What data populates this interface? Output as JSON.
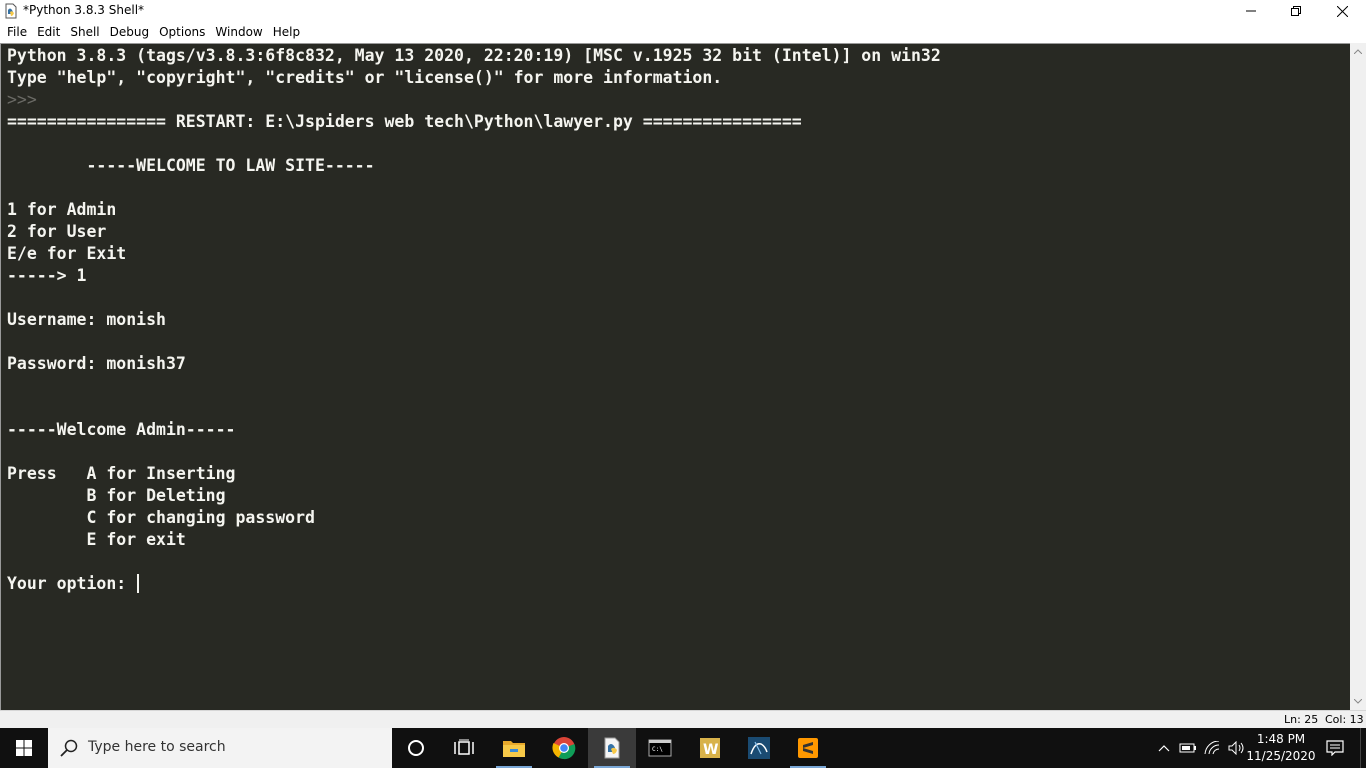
{
  "window": {
    "title": "*Python 3.8.3 Shell*"
  },
  "menu": [
    "File",
    "Edit",
    "Shell",
    "Debug",
    "Options",
    "Window",
    "Help"
  ],
  "shell": {
    "lines": [
      {
        "text": "Python 3.8.3 (tags/v3.8.3:6f8c832, May 13 2020, 22:20:19) [MSC v.1925 32 bit (Intel)] on win32",
        "kind": "output"
      },
      {
        "text": "Type \"help\", \"copyright\", \"credits\" or \"license()\" for more information.",
        "kind": "output"
      },
      {
        "text": ">>> ",
        "kind": "prompt"
      },
      {
        "text": "================ RESTART: E:\\Jspiders web tech\\Python\\lawyer.py ================",
        "kind": "output"
      },
      {
        "text": "",
        "kind": "output"
      },
      {
        "text": "        -----WELCOME TO LAW SITE-----",
        "kind": "output"
      },
      {
        "text": "",
        "kind": "output"
      },
      {
        "text": "1 for Admin",
        "kind": "output"
      },
      {
        "text": "2 for User",
        "kind": "output"
      },
      {
        "text": "E/e for Exit",
        "kind": "output"
      },
      {
        "text": "-----> 1",
        "kind": "output"
      },
      {
        "text": "",
        "kind": "output"
      },
      {
        "text": "Username: monish",
        "kind": "output"
      },
      {
        "text": "",
        "kind": "output"
      },
      {
        "text": "Password: monish37",
        "kind": "output"
      },
      {
        "text": "",
        "kind": "output"
      },
      {
        "text": "",
        "kind": "output"
      },
      {
        "text": "-----Welcome Admin-----",
        "kind": "output"
      },
      {
        "text": "",
        "kind": "output"
      },
      {
        "text": "Press   A for Inserting",
        "kind": "output"
      },
      {
        "text": "        B for Deleting",
        "kind": "output"
      },
      {
        "text": "        C for changing password",
        "kind": "output"
      },
      {
        "text": "        E for exit",
        "kind": "output"
      },
      {
        "text": "",
        "kind": "output"
      },
      {
        "text": "Your option: ",
        "kind": "input"
      }
    ]
  },
  "status": {
    "ln": "Ln: 25",
    "col": "Col: 13"
  },
  "taskbar": {
    "search_placeholder": "Type here to search",
    "apps": [
      "cortana-icon",
      "task-view-icon",
      "file-explorer-icon",
      "chrome-icon",
      "python-idle-icon",
      "command-prompt-icon",
      "word-icon",
      "mysql-workbench-icon",
      "sublime-text-icon"
    ],
    "time": "1:48 PM",
    "date": "11/25/2020"
  },
  "colors": {
    "shell_bg": "#282923",
    "shell_text": "#f5f5f0",
    "prompt_text": "#6b6b66",
    "taskbar_bg": "#101010"
  }
}
